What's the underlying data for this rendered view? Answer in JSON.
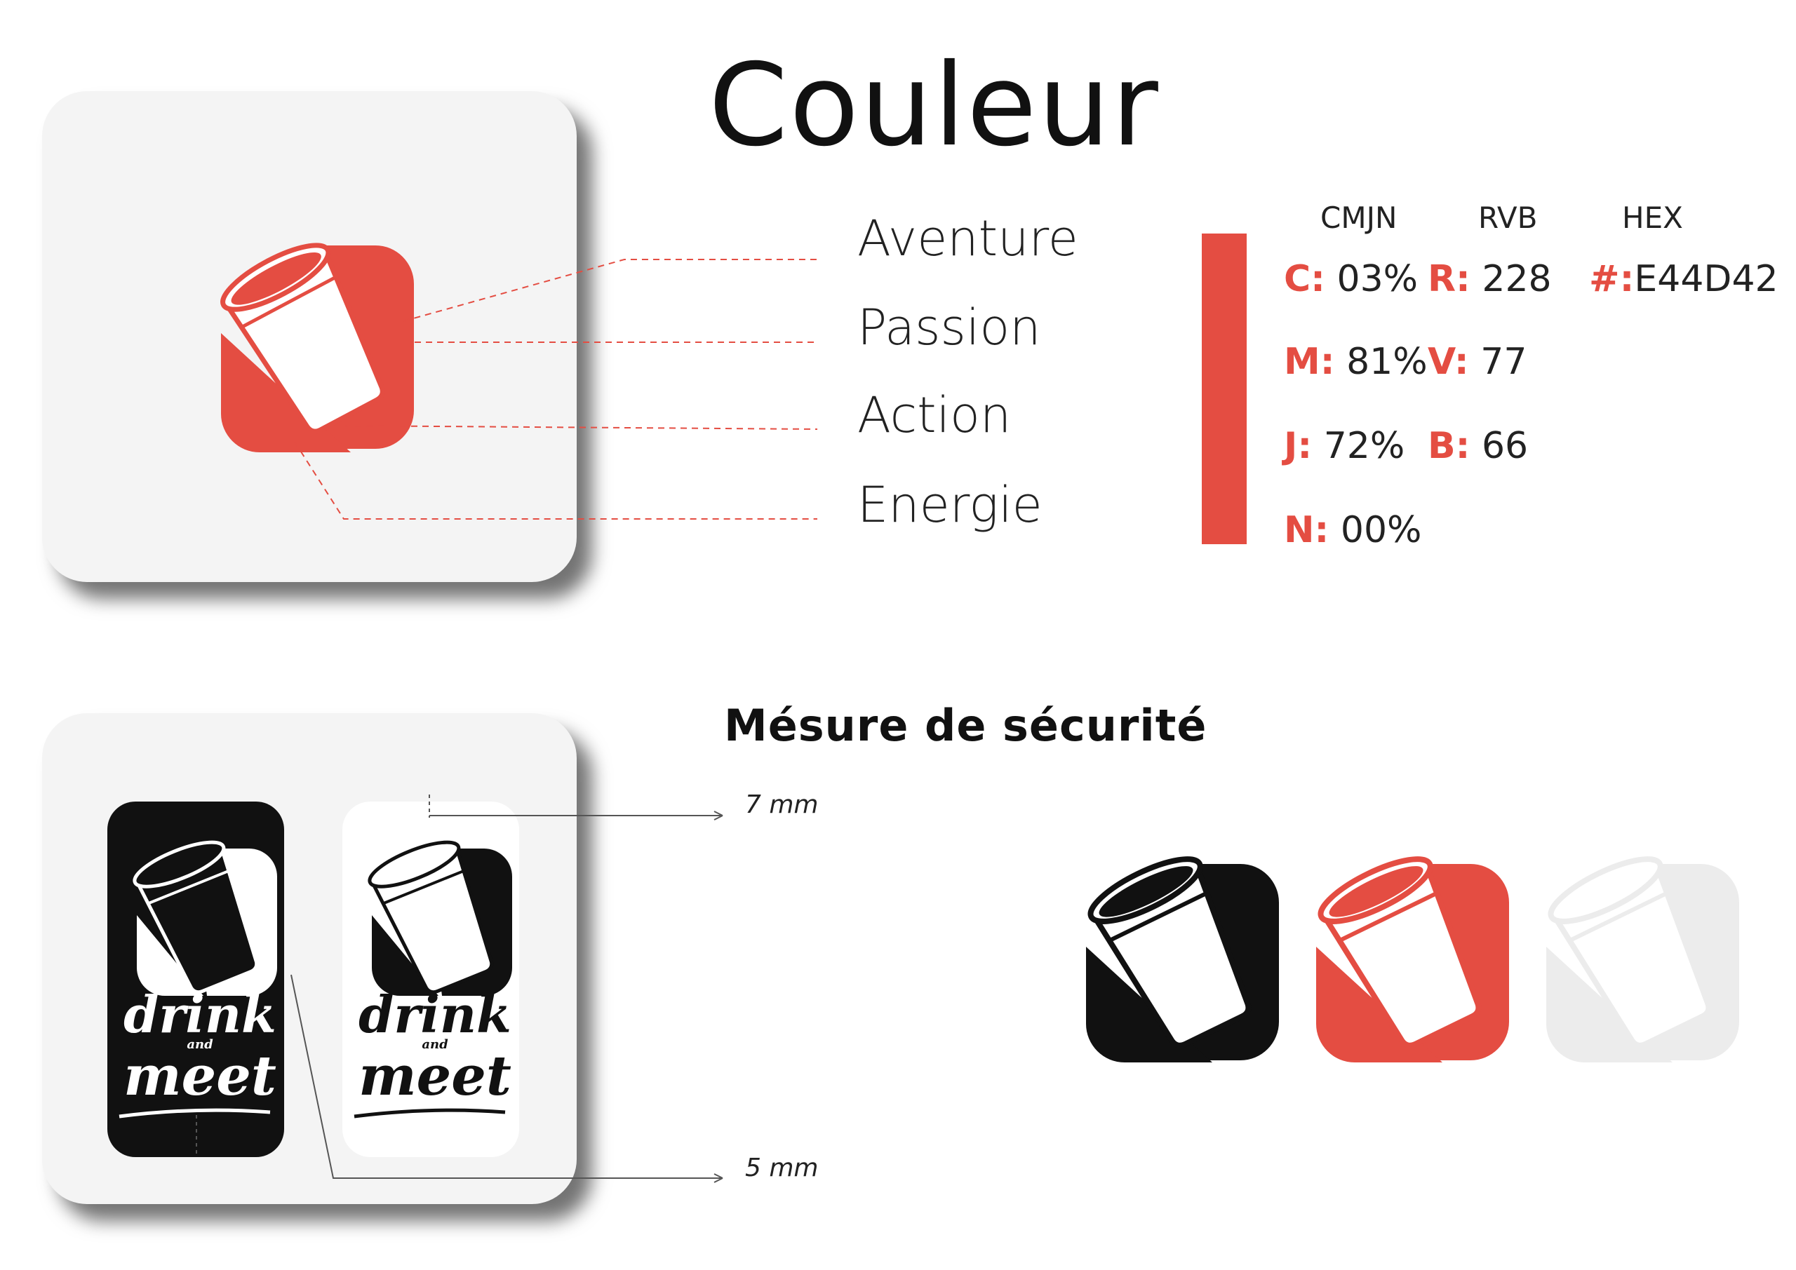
{
  "title": "Couleur",
  "subtitle": "Mésure de sécurité",
  "meanings": [
    "Aventure",
    "Passion",
    "Action",
    "Energie"
  ],
  "color_table": {
    "headers": [
      "CMJN",
      "RVB",
      "HEX"
    ],
    "cmjn": [
      {
        "key": "C:",
        "value": "03%"
      },
      {
        "key": "M:",
        "value": "81%"
      },
      {
        "key": "J:",
        "value": "72%"
      },
      {
        "key": "N:",
        "value": "00%"
      }
    ],
    "rvb": [
      {
        "key": "R:",
        "value": "228"
      },
      {
        "key": "V:",
        "value": "77"
      },
      {
        "key": "B:",
        "value": "66"
      }
    ],
    "hex": {
      "key": "#:",
      "value": "E44D42"
    }
  },
  "brand_color": "#E44D42",
  "logo_text": {
    "line1": "drink",
    "line2": "and",
    "line3": "meet"
  },
  "measures": {
    "top": "7 mm",
    "bottom": "5 mm"
  },
  "icons": {
    "logo": "cup-logo-icon"
  },
  "variants": [
    "black",
    "red",
    "light-grey"
  ]
}
